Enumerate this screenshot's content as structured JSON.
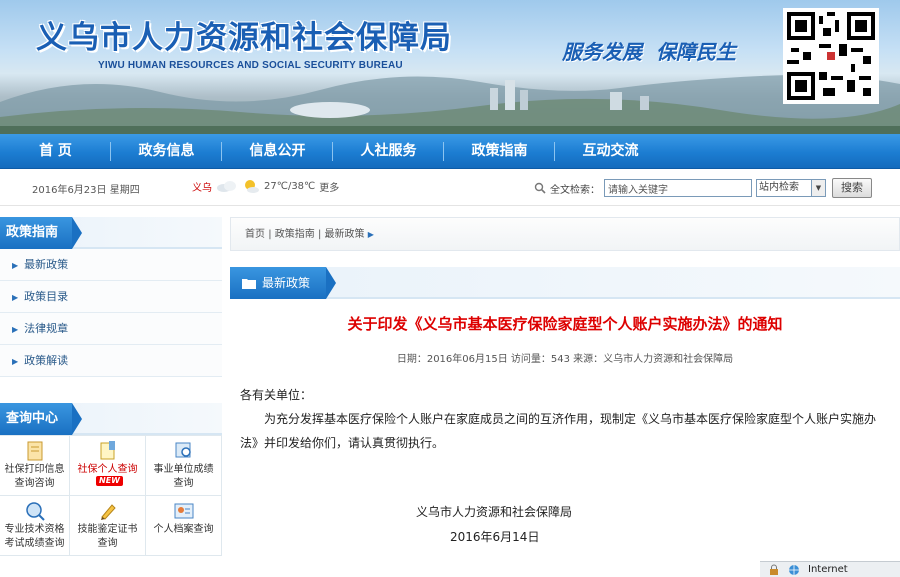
{
  "header": {
    "title": "义乌市人力资源和社会保障局",
    "subtitle": "YIWU HUMAN RESOURCES AND SOCIAL SECURITY BUREAU",
    "slogan_left": "服务发展",
    "slogan_right": "保障民生"
  },
  "nav": {
    "items": [
      "首 页",
      "政务信息",
      "信息公开",
      "人社服务",
      "政策指南",
      "互动交流"
    ]
  },
  "infobar": {
    "date": "2016年6月23日  星期四",
    "city": "义乌",
    "temperature": "27℃/38℃",
    "weather_more": "更多",
    "search_label": "全文检索：",
    "search_placeholder": "请输入关键字",
    "search_scope": "站内检索",
    "search_button": "搜索"
  },
  "sidebar": {
    "policy_title": "政策指南",
    "policy_items": [
      "最新政策",
      "政策目录",
      "法律规章",
      "政策解读"
    ],
    "query_title": "查询中心",
    "query_cells": [
      {
        "line1": "社保打印信息",
        "line2": "查询咨询"
      },
      {
        "line1": "社保个人查询",
        "line2": "",
        "badge": "NEW"
      },
      {
        "line1": "事业单位成绩",
        "line2": "查询"
      },
      {
        "line1": "专业技术资格",
        "line2": "考试成绩查询"
      },
      {
        "line1": "技能鉴定证书",
        "line2": "查询"
      },
      {
        "line1": "个人档案查询",
        "line2": ""
      }
    ]
  },
  "main": {
    "breadcrumb": [
      "首页",
      "政策指南",
      "最新政策"
    ],
    "section_title": "最新政策",
    "article_title": "关于印发《义乌市基本医疗保险家庭型个人账户实施办法》的通知",
    "meta": "日期：2016年06月15日  访问量：543  来源：义乌市人力资源和社会保障局",
    "salutation": "各有关单位：",
    "body": "为充分发挥基本医疗保险个人账户在家庭成员之间的互济作用，现制定《义乌市基本医疗保险家庭型个人账户实施办法》并印发给你们，请认真贯彻执行。",
    "signature": "义乌市人力资源和社会保障局",
    "sign_date": "2016年6月14日"
  },
  "statusbar": {
    "zone": "Internet"
  }
}
